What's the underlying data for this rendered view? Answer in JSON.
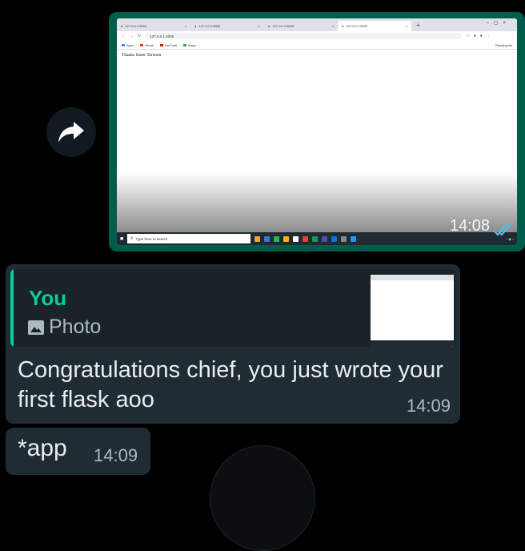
{
  "photo_message": {
    "time": "14:08",
    "screenshot": {
      "tabs": [
        {
          "label": "127.0.0.1:3000",
          "active": false
        },
        {
          "label": "127.0.0.1:5000",
          "active": false
        },
        {
          "label": "127.0.0.1:5000",
          "active": false
        },
        {
          "label": "127.0.0.1:5000",
          "active": true
        }
      ],
      "url": "127.0.0.1:5000",
      "bookmarks": [
        "Apps",
        "Gmail",
        "YouTube",
        "Maps"
      ],
      "reading_list": "Reading list",
      "page_text": "Thanks Sister Terresin",
      "taskbar_search": "Type here to search"
    }
  },
  "reply_message": {
    "quote_author": "You",
    "quote_type": "Photo",
    "text": "Congratulations chief, you just wrote your first flask aoo",
    "time": "14:09"
  },
  "followup_message": {
    "text": "*app",
    "time": "14:09"
  },
  "colors": {
    "outgoing_bubble": "#005c4b",
    "incoming_bubble": "#202c33",
    "accent": "#06cf9c",
    "read_ticks": "#53bdeb"
  }
}
